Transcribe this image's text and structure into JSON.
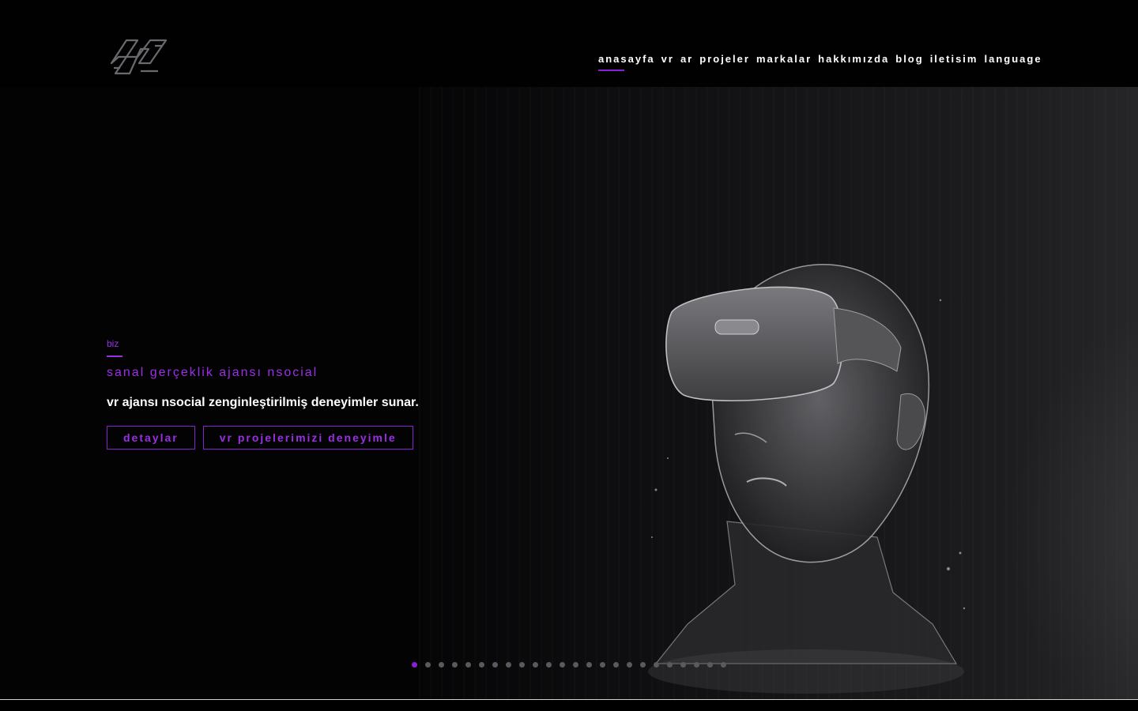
{
  "nav": {
    "items": [
      {
        "label": "anasayfa",
        "active": true
      },
      {
        "label": "vr",
        "active": false
      },
      {
        "label": "ar",
        "active": false
      },
      {
        "label": "projeler",
        "active": false
      },
      {
        "label": "markalar",
        "active": false
      },
      {
        "label": "hakkımızda",
        "active": false
      },
      {
        "label": "blog",
        "active": false
      },
      {
        "label": "iletisim",
        "active": false
      },
      {
        "label": "language",
        "active": false
      }
    ]
  },
  "hero": {
    "eyebrow": "biz",
    "headline": "sanal gerçeklik ajansı nsocial",
    "subhead": "vr ajansı nsocial zenginleştirilmiş deneyimler sunar.",
    "primary_button": "detaylar",
    "secondary_button": "vr projelerimizi deneyimle"
  },
  "slider": {
    "total_slides": 24,
    "active_index": 0
  },
  "colors": {
    "accent": "#8a1fd8",
    "accent_text": "#9b2fe6",
    "background": "#030304",
    "dot_inactive": "#5a5a5e"
  },
  "icons": {
    "logo": "nsocial-logo-icon",
    "hero_image": "vr-headset-head-icon"
  }
}
